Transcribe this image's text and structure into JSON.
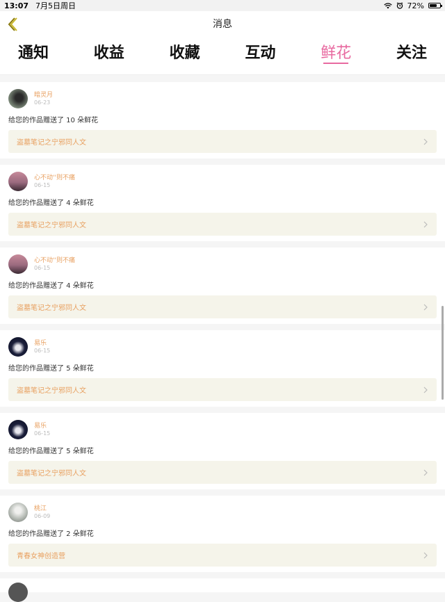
{
  "status": {
    "time": "13:07",
    "date": "7月5日周日",
    "battery": "72%",
    "battery_level": 0.72
  },
  "nav": {
    "title": "消息"
  },
  "tabs": [
    {
      "label": "通知"
    },
    {
      "label": "收益"
    },
    {
      "label": "收藏"
    },
    {
      "label": "互动"
    },
    {
      "label": "鲜花"
    },
    {
      "label": "关注"
    }
  ],
  "active_tab": "鲜花",
  "colors": {
    "accent": "#e86aa0",
    "name": "#e8a060",
    "work_bg": "#f5f4ea"
  },
  "messages": [
    {
      "name": "暗灵月",
      "date": "06-23",
      "text": "给您的作品赠送了 10 朵鲜花",
      "work": "盗墓笔记之宁邪同人文",
      "avatar": "avatar-dark"
    },
    {
      "name": "心不动''则不痛",
      "date": "06-15",
      "text": "给您的作品赠送了 4 朵鲜花",
      "work": "盗墓笔记之宁邪同人文",
      "avatar": "avatar-sunset"
    },
    {
      "name": "心不动''则不痛",
      "date": "06-15",
      "text": "给您的作品赠送了 4 朵鲜花",
      "work": "盗墓笔记之宁邪同人文",
      "avatar": "avatar-sunset"
    },
    {
      "name": "易乐",
      "date": "06-15",
      "text": "给您的作品赠送了 5 朵鲜花",
      "work": "盗墓笔记之宁邪同人文",
      "avatar": "avatar-night"
    },
    {
      "name": "易乐",
      "date": "06-15",
      "text": "给您的作品赠送了 5 朵鲜花",
      "work": "盗墓笔记之宁邪同人文",
      "avatar": "avatar-night"
    },
    {
      "name": "桃江",
      "date": "06-09",
      "text": "给您的作品赠送了 2 朵鲜花",
      "work": "青春女神创造营",
      "avatar": "avatar-light"
    }
  ]
}
